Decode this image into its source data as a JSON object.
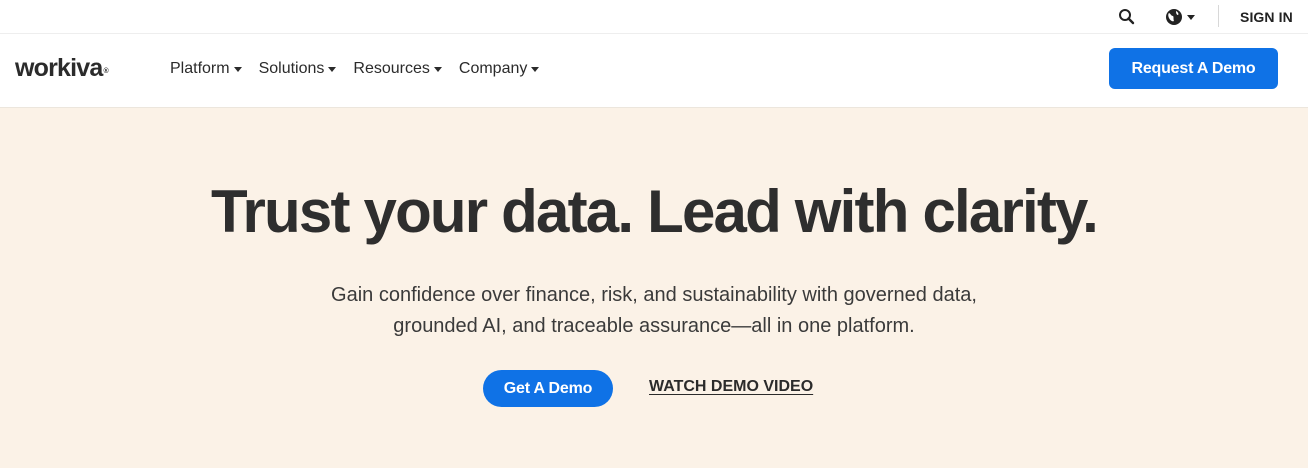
{
  "utility": {
    "search_icon": "search-icon",
    "globe_icon": "globe-icon",
    "signin_label": "SIGN IN"
  },
  "nav": {
    "logo_text": "workiva",
    "logo_mark": "®",
    "items": [
      {
        "label": "Platform"
      },
      {
        "label": "Solutions"
      },
      {
        "label": "Resources"
      },
      {
        "label": "Company"
      }
    ],
    "cta_label": "Request A Demo"
  },
  "hero": {
    "title": "Trust your data. Lead with clarity.",
    "subtitle": "Gain confidence over finance, risk, and sustainability with governed data, grounded AI, and traceable assurance—all in one platform.",
    "primary_cta": "Get A Demo",
    "secondary_cta": "WATCH DEMO VIDEO"
  },
  "colors": {
    "accent": "#0f72e6",
    "hero_bg": "#fbf2e7",
    "text": "#2e2e2e"
  }
}
